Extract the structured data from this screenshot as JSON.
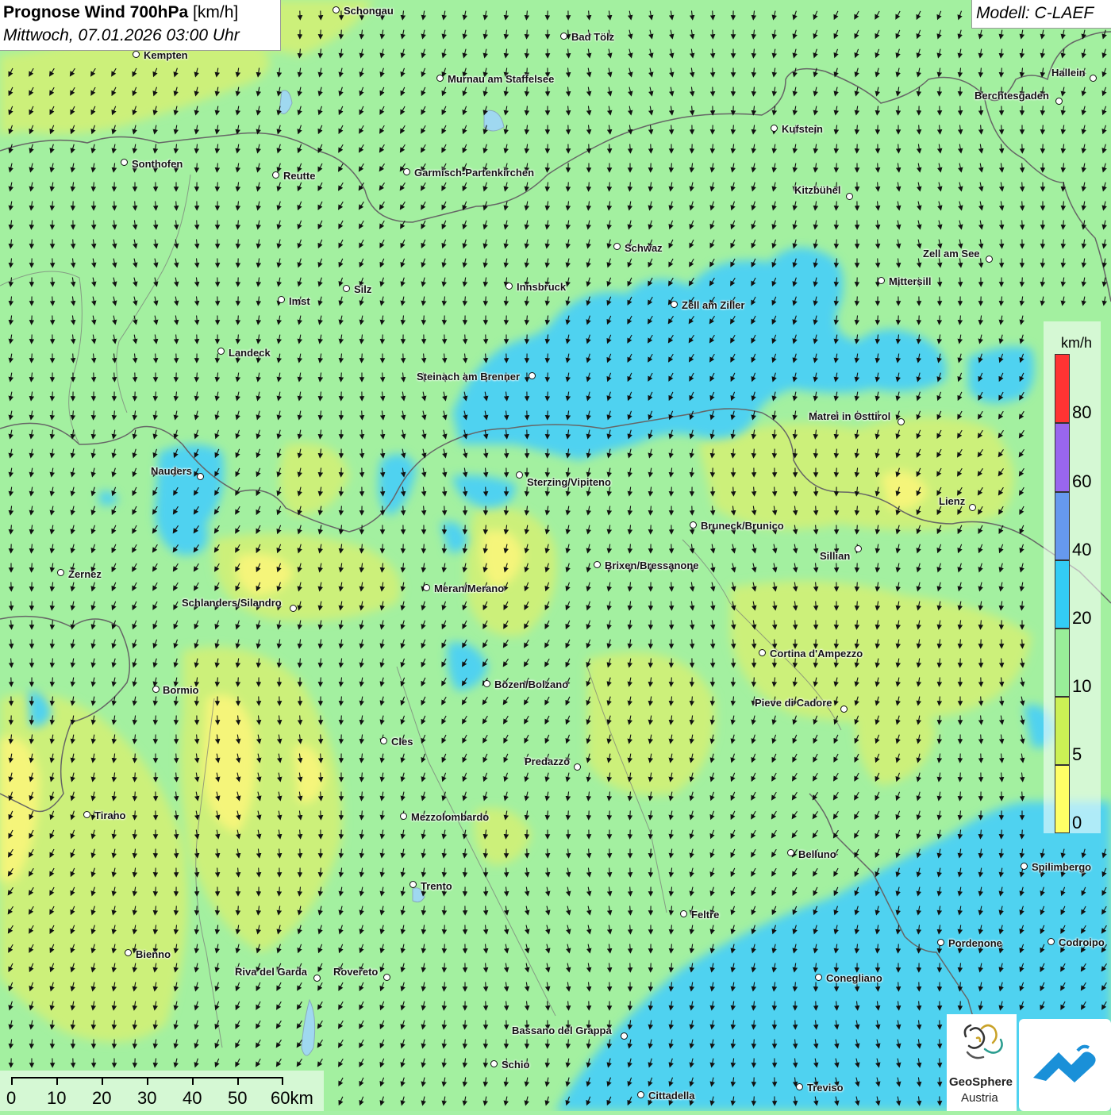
{
  "header": {
    "title_bold": "Prognose Wind 700hPa",
    "title_unit": "[km/h]",
    "datetime": "Mittwoch, 07.01.2026 03:00 Uhr"
  },
  "model_label": "Modell: C-LAEF",
  "legend": {
    "unit": "km/h",
    "labels": [
      "80",
      "60",
      "40",
      "20",
      "10",
      "5",
      "0"
    ],
    "colors": {
      "red": "#ff3333",
      "purple": "#9966ee",
      "blue": "#6699ee",
      "cyan": "#33ccf5",
      "green": "#99ee99",
      "yellowgreen": "#ccf055",
      "yellow": "#ffff66"
    }
  },
  "scale_bar": {
    "labels": [
      "0",
      "10",
      "20",
      "30",
      "40",
      "50",
      "60km"
    ]
  },
  "logo": {
    "name_line1": "GeoSphere",
    "name_line2": "Austria"
  },
  "cities": [
    {
      "name": "Schongau"
    },
    {
      "name": "Bad Tölz"
    },
    {
      "name": "Kempten"
    },
    {
      "name": "Murnau am Staffelsee"
    },
    {
      "name": "Hallein"
    },
    {
      "name": "Berchtesgaden"
    },
    {
      "name": "Kufstein"
    },
    {
      "name": "Sonthofen"
    },
    {
      "name": "Reutte"
    },
    {
      "name": "Garmisch-Partenkirchen"
    },
    {
      "name": "Kitzbühel"
    },
    {
      "name": "Schwaz"
    },
    {
      "name": "Zell am See"
    },
    {
      "name": "Mittersill"
    },
    {
      "name": "Innsbruck"
    },
    {
      "name": "Silz"
    },
    {
      "name": "Imst"
    },
    {
      "name": "Zell am Ziller"
    },
    {
      "name": "Landeck"
    },
    {
      "name": "Steinach am Brenner"
    },
    {
      "name": "Matrei in Osttirol"
    },
    {
      "name": "Nauders"
    },
    {
      "name": "Sterzing/Vipiteno"
    },
    {
      "name": "Lienz"
    },
    {
      "name": "Bruneck/Brunico"
    },
    {
      "name": "Sillian"
    },
    {
      "name": "Brixen/Bressanone"
    },
    {
      "name": "Zernez"
    },
    {
      "name": "Meran/Merano"
    },
    {
      "name": "Schlanders/Silandro"
    },
    {
      "name": "Cortina d'Ampezzo"
    },
    {
      "name": "Bozen/Bolzano"
    },
    {
      "name": "Bormio"
    },
    {
      "name": "Pieve di Cadore"
    },
    {
      "name": "Cles"
    },
    {
      "name": "Predazzo"
    },
    {
      "name": "Tirano"
    },
    {
      "name": "Mezzolombardo"
    },
    {
      "name": "Belluno"
    },
    {
      "name": "Spilimbergo"
    },
    {
      "name": "Trento"
    },
    {
      "name": "Feltre"
    },
    {
      "name": "Pordenone"
    },
    {
      "name": "Codroipo"
    },
    {
      "name": "Bienno"
    },
    {
      "name": "Riva del Garda"
    },
    {
      "name": "Rovereto"
    },
    {
      "name": "Conegliano"
    },
    {
      "name": "Bassano del Grappa"
    },
    {
      "name": "Schio"
    },
    {
      "name": "Treviso"
    },
    {
      "name": "Cittadella"
    }
  ]
}
